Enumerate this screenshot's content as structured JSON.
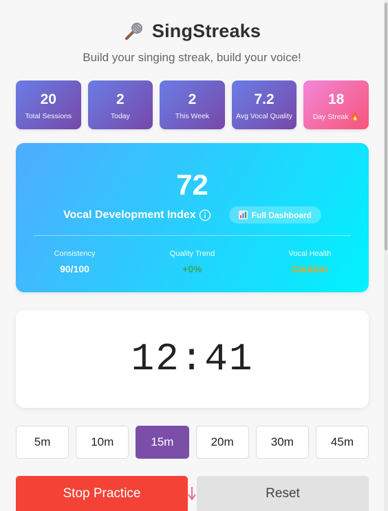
{
  "header": {
    "title": "SingStreaks",
    "subtitle": "Build your singing streak, build your voice!",
    "icon": "microphone-icon"
  },
  "stats": [
    {
      "value": "20",
      "label": "Total Sessions"
    },
    {
      "value": "2",
      "label": "Today"
    },
    {
      "value": "2",
      "label": "This Week"
    },
    {
      "value": "7.2",
      "label": "Avg Vocal Quality"
    },
    {
      "value": "18",
      "label": "Day Streak 🔥"
    }
  ],
  "vdi": {
    "score": "72",
    "label": "Vocal Development Index",
    "info_icon": "info-icon",
    "dashboard_button": "Full Dashboard",
    "metrics": [
      {
        "label": "Consistency",
        "value": "90/100"
      },
      {
        "label": "Quality Trend",
        "value": "+0%"
      },
      {
        "label": "Vocal Health",
        "value": "Caution"
      }
    ]
  },
  "timer": {
    "display": "12:41"
  },
  "durations": {
    "options": [
      "5m",
      "10m",
      "15m",
      "20m",
      "30m",
      "45m"
    ],
    "selected": "15m"
  },
  "actions": {
    "stop_label": "Stop Practice",
    "reset_label": "Reset"
  },
  "colors": {
    "stat_gradient": [
      "#6a7de6",
      "#7648a8"
    ],
    "streak_gradient": [
      "#f386d8",
      "#f7557a"
    ],
    "vdi_gradient": [
      "#4facfe",
      "#00f2fe"
    ],
    "active_duration": "#7b4ea8",
    "stop_button": "#f44336",
    "trend_value": "#3aa55a",
    "health_value": "#f0a21b"
  }
}
